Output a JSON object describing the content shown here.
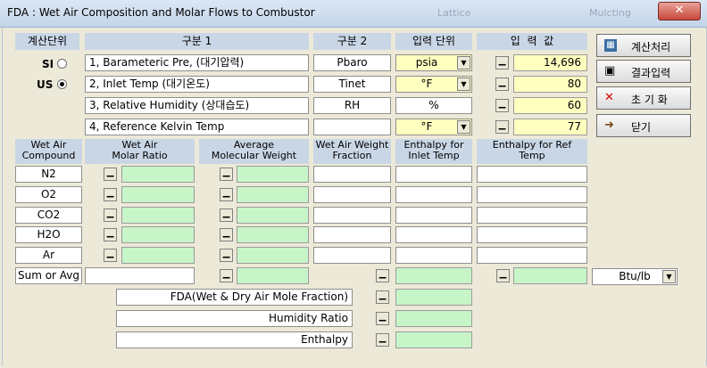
{
  "window": {
    "title": "FDA : Wet Air Composition and Molar Flows to Combustor",
    "bg_title_1": "Lattice",
    "bg_title_2": "Mulcting",
    "close_glyph": "✕"
  },
  "units_section": {
    "header": "계산단위",
    "si_label": "SI",
    "us_label": "US",
    "selected": "US"
  },
  "table_headers": {
    "col1": "구분 1",
    "col2": "구분 2",
    "col3": "입력 단위",
    "col4": "입  력  값"
  },
  "inputs": [
    {
      "desc": "1, Barameteric Pre, (대기압력)",
      "symbol": "Pbaro",
      "unit": "psia",
      "has_dropdown": true,
      "value": "14,696"
    },
    {
      "desc": "2, Inlet Temp (대기온도)",
      "symbol": "Tinet",
      "unit": "°F",
      "has_dropdown": true,
      "value": "80"
    },
    {
      "desc": "3, Relative Humidity (상대습도)",
      "symbol": "RH",
      "unit": "%",
      "has_dropdown": false,
      "value": "60"
    },
    {
      "desc": "4, Reference  Kelvin Temp",
      "symbol": "",
      "unit": "°F",
      "has_dropdown": true,
      "value": "77"
    }
  ],
  "buttons": {
    "calc": {
      "label": "계산처리",
      "icon": "calculator-icon"
    },
    "save": {
      "label": "결과입력",
      "icon": "floppy-disk-icon"
    },
    "reset": {
      "label": "초 기 화",
      "icon": "red-x-icon"
    },
    "close": {
      "label": "닫기",
      "icon": "door-exit-icon"
    }
  },
  "comp_headers": {
    "compound": "Wet Air\nCompound",
    "molar_ratio": "Wet Air\nMolar Ratio",
    "mol_weight": "Average\nMolecular Weight",
    "weight_frac": "Wet Air Weight\nFraction",
    "enth_inlet": "Enthalpy for\nInlet Temp",
    "enth_ref": "Enthalpy for Ref\nTemp"
  },
  "compounds": [
    "N2",
    "O2",
    "CO2",
    "H2O",
    "Ar"
  ],
  "sum_label": "Sum or Avg",
  "enthalpy_unit": "Btu/lb",
  "bottom_rows": [
    {
      "label": "FDA(Wet & Dry Air Mole Fraction)"
    },
    {
      "label": "Humidity Ratio"
    },
    {
      "label": "Enthalpy"
    }
  ],
  "small_button_glyph": "▁",
  "dropdown_glyph": "▼"
}
